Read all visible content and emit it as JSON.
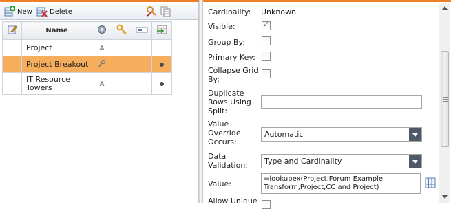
{
  "toolbar": {
    "new_label": "New",
    "delete_label": "Delete"
  },
  "grid": {
    "header_name": "Name",
    "rows": [
      {
        "name": "Project",
        "type_glyph": "A",
        "selected": false,
        "has_dot": false
      },
      {
        "name": "Project Breakout",
        "type_glyph": "key",
        "selected": true,
        "has_dot": true
      },
      {
        "name": "IT Resource Towers",
        "type_glyph": "A",
        "selected": false,
        "has_dot": true
      }
    ]
  },
  "properties": {
    "cardinality_label": "Cardinality:",
    "cardinality_value": "Unknown",
    "visible_label": "Visible:",
    "visible_checked": true,
    "group_by_label": "Group By:",
    "group_by_checked": false,
    "primary_key_label": "Primary Key:",
    "primary_key_checked": false,
    "collapse_grid_label": "Collapse Grid By:",
    "collapse_grid_checked": false,
    "duplicate_rows_label": "Duplicate Rows Using Split:",
    "duplicate_rows_value": "",
    "value_override_label": "Value Override Occurs:",
    "value_override_value": "Automatic",
    "data_validation_label": "Data Validation:",
    "data_validation_value": "Type and Cardinality",
    "value_label": "Value:",
    "value_value": "=lookupex(Project,Forum Example Transform,Project,CC and Project)",
    "allow_unique_label": "Allow Unique"
  },
  "colors": {
    "accent": "#ef7f24",
    "selected_row": "#f7ae5c",
    "dropdown_arrow_bg": "#4e5968"
  }
}
